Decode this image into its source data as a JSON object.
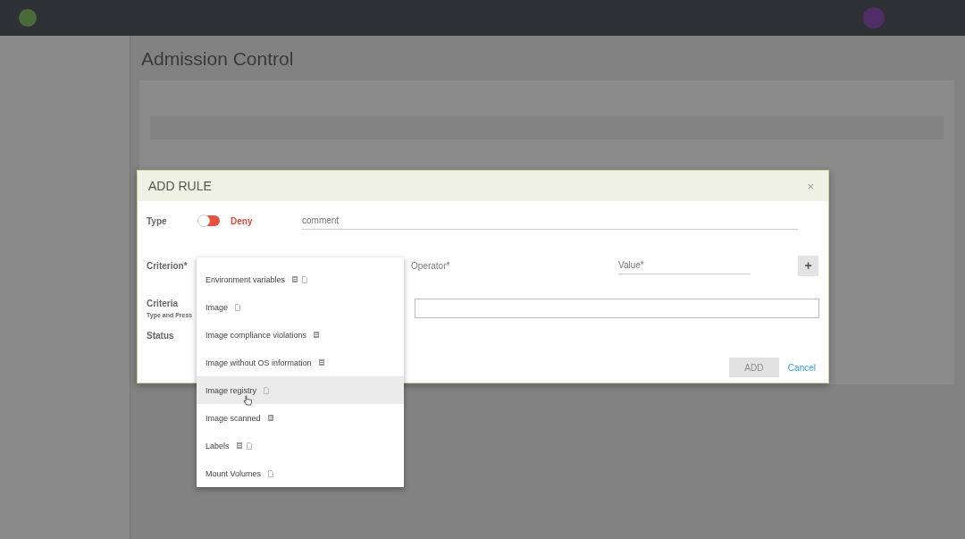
{
  "page": {
    "title": "Admission Control"
  },
  "dialog": {
    "title": "ADD RULE",
    "close": "×",
    "type": {
      "label": "Type",
      "on": false,
      "value": "Deny"
    },
    "comment": {
      "placeholder": "comment"
    },
    "criterion": {
      "label": "Criterion*"
    },
    "operator": {
      "label": "Operator*"
    },
    "value": {
      "placeholder": "Value*"
    },
    "add_criterion": "+",
    "criteria": {
      "label": "Criteria",
      "hint": "Type and Press"
    },
    "status": {
      "label": "Status"
    },
    "buttons": [
      {
        "label": "ADD",
        "kind": "primary",
        "disabled": true
      },
      {
        "label": "Cancel",
        "kind": "link",
        "disabled": false
      }
    ]
  },
  "dropdown": {
    "items": [
      {
        "label": "Environment variables",
        "kind": "both",
        "selected": false
      },
      {
        "label": "Image",
        "kind": "file",
        "selected": false
      },
      {
        "label": "Image compliance violations",
        "kind": "list",
        "selected": false
      },
      {
        "label": "Image without OS information",
        "kind": "list",
        "selected": false
      },
      {
        "label": "Image registry",
        "kind": "file",
        "selected": true
      },
      {
        "label": "Image scanned",
        "kind": "list",
        "selected": false
      },
      {
        "label": "Labels",
        "kind": "both",
        "selected": false
      },
      {
        "label": "Mount Volumes",
        "kind": "file",
        "selected": false
      }
    ]
  }
}
